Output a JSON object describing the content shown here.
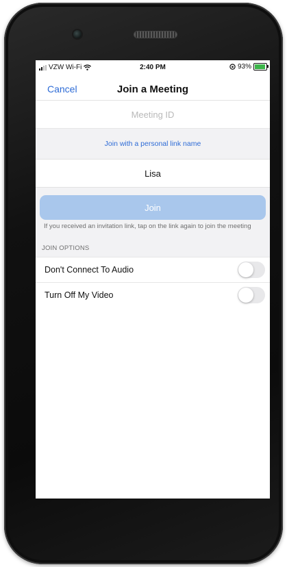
{
  "status_bar": {
    "carrier": "VZW Wi-Fi",
    "time": "2:40 PM",
    "battery_percent": "93%",
    "battery_level": 0.93,
    "icons": [
      "signal-icon",
      "wifi-icon",
      "orientation-lock-icon",
      "battery-icon"
    ]
  },
  "nav": {
    "cancel_label": "Cancel",
    "title": "Join a Meeting"
  },
  "meeting_id": {
    "placeholder": "Meeting ID",
    "value": ""
  },
  "personal_link_label": "Join with a personal link name",
  "display_name": "Lisa",
  "join_button_label": "Join",
  "helper_text": "If you received an invitation link, tap on the link again to join the meeting",
  "join_options": {
    "header": "JOIN OPTIONS",
    "items": [
      {
        "label": "Don't Connect To Audio",
        "enabled": false
      },
      {
        "label": "Turn Off My Video",
        "enabled": false
      }
    ]
  },
  "colors": {
    "accent": "#2d6bd6",
    "join_button_disabled": "#a9c7ec",
    "background_gray": "#f2f2f4"
  }
}
